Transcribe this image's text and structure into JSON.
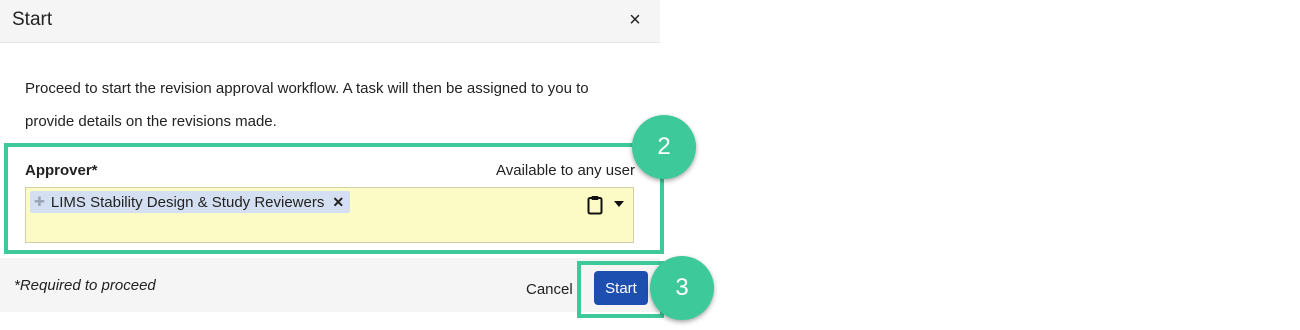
{
  "dialog": {
    "title": "Start",
    "close_label": "×",
    "description": "Proceed to start the revision approval workflow. A task will then be assigned to you to provide details on the revisions made."
  },
  "approver": {
    "label": "Approver*",
    "availability": "Available to any user",
    "selected_chip": "LIMS Stability Design & Study Reviewers",
    "chip_remove": "✕",
    "icons": [
      "clipboard-icon",
      "caret-down-icon",
      "plus-icon",
      "remove-icon"
    ],
    "field_color": "#fdfbc5",
    "chip_color": "#d4e0f1"
  },
  "footer": {
    "required_note": "*Required to proceed",
    "cancel_label": "Cancel",
    "start_label": "Start",
    "start_color": "#1d4fb1"
  },
  "annotations": {
    "step_approver": "2",
    "step_start": "3",
    "highlight_color": "#3ec99b"
  }
}
